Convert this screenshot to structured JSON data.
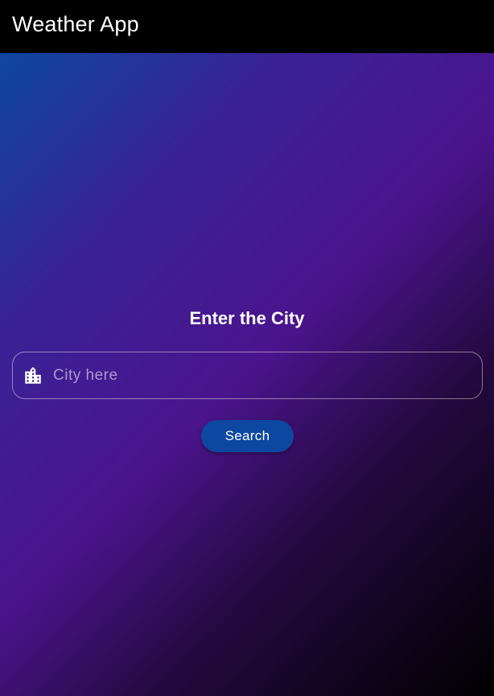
{
  "app": {
    "title": "Weather App"
  },
  "main": {
    "heading": "Enter the City",
    "search_field": {
      "value": "",
      "placeholder": "City here",
      "icon": "city-buildings-icon"
    },
    "search_button_label": "Search"
  },
  "colors": {
    "appbar": "#000000",
    "button": "#0d47a1",
    "gradient_start": "#0d47a1",
    "gradient_mid": "#4a148c",
    "gradient_end": "#000000"
  }
}
